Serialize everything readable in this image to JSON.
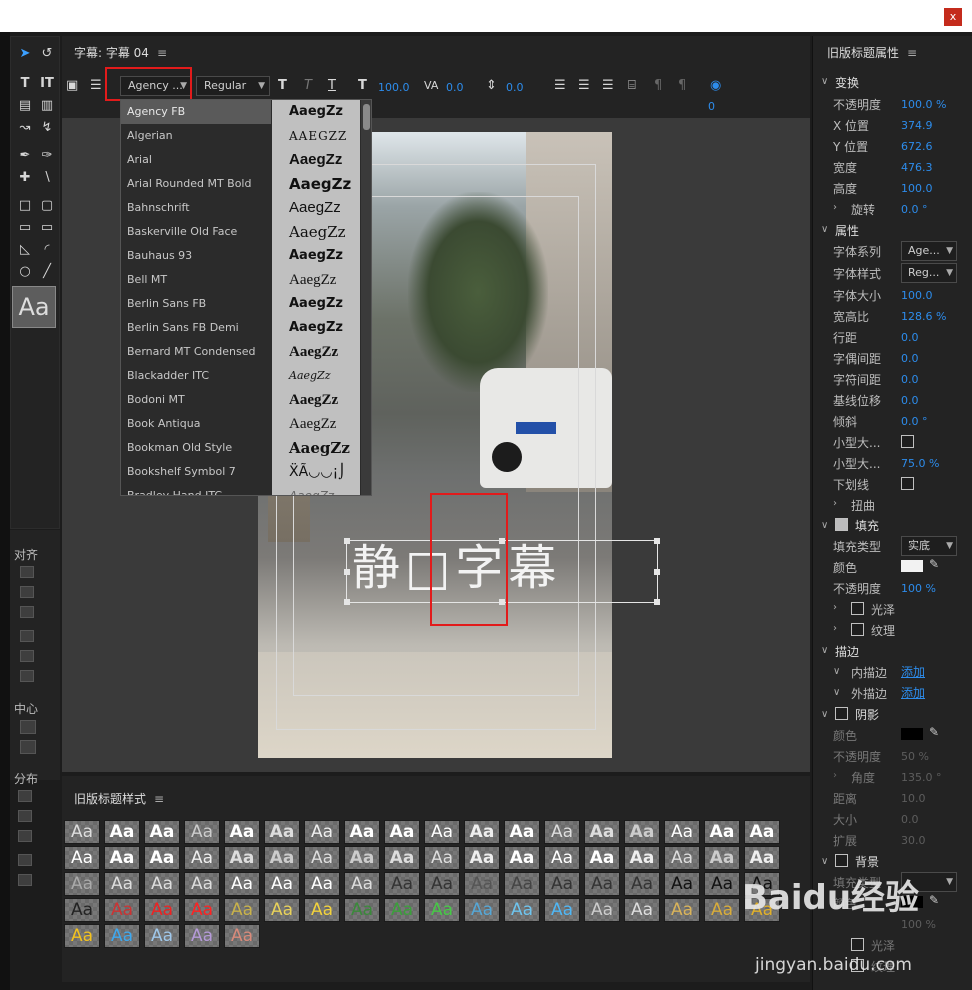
{
  "window": {
    "close_label": "x"
  },
  "title_panel": {
    "title": "字幕: 字幕 04",
    "menu": "≡"
  },
  "toolbar": {
    "font_family": "Agency ...",
    "font_style": "Regular",
    "bold": "T",
    "italic": "T",
    "underline": "T",
    "font_size": "100.0",
    "kerning": "0.0",
    "baseline": "0.0",
    "tab_value": "0"
  },
  "font_list": {
    "items": [
      {
        "name": "Agency FB",
        "preview": "AaegZz"
      },
      {
        "name": "Algerian",
        "preview": "AAEGZZ"
      },
      {
        "name": "Arial",
        "preview": "AaegZz"
      },
      {
        "name": "Arial Rounded MT Bold",
        "preview": "AaegZz"
      },
      {
        "name": "Bahnschrift",
        "preview": "AaegZz"
      },
      {
        "name": "Baskerville Old Face",
        "preview": "AaegZz"
      },
      {
        "name": "Bauhaus 93",
        "preview": "AaegZz"
      },
      {
        "name": "Bell MT",
        "preview": "AaegZz"
      },
      {
        "name": "Berlin Sans FB",
        "preview": "AaegZz"
      },
      {
        "name": "Berlin Sans FB Demi",
        "preview": "AaegZz"
      },
      {
        "name": "Bernard MT Condensed",
        "preview": "AaegZz"
      },
      {
        "name": "Blackadder ITC",
        "preview": "AaegZz"
      },
      {
        "name": "Bodoni MT",
        "preview": "AaegZz"
      },
      {
        "name": "Book Antiqua",
        "preview": "AaegZz"
      },
      {
        "name": "Bookman Old Style",
        "preview": "AaegZz"
      },
      {
        "name": "Bookshelf Symbol 7",
        "preview": "ẌÃ◡◡¡⌡"
      },
      {
        "name": "Bradley Hand ITC",
        "preview": "AaegZz"
      }
    ]
  },
  "canvas": {
    "text": "静□字幕"
  },
  "left_panel": {
    "align": "对齐",
    "center": "中心",
    "distribute": "分布"
  },
  "styles_panel": {
    "title": "旧版标题样式",
    "menu": "≡",
    "swatch_label": "Aa"
  },
  "props": {
    "title": "旧版标题属性",
    "menu": "≡",
    "transform": "变换",
    "opacity_label": "不透明度",
    "opacity": "100.0 %",
    "x_label": "X 位置",
    "x": "374.9",
    "y_label": "Y 位置",
    "y": "672.6",
    "width_label": "宽度",
    "width": "476.3",
    "height_label": "高度",
    "height": "100.0",
    "rotation_label": "旋转",
    "rotation": "0.0 °",
    "attributes": "属性",
    "font_family_label": "字体系列",
    "font_family": "Age...",
    "font_style_label": "字体样式",
    "font_style": "Reg...",
    "font_size_label": "字体大小",
    "font_size": "100.0",
    "aspect_label": "宽高比",
    "aspect": "128.6 %",
    "leading_label": "行距",
    "leading": "0.0",
    "kerning_label": "字偶间距",
    "kerning": "0.0",
    "tracking_label": "字符间距",
    "tracking": "0.0",
    "baseline_label": "基线位移",
    "baseline": "0.0",
    "slant_label": "倾斜",
    "slant": "0.0 °",
    "smallcaps_label": "小型大...",
    "smallcaps_size_label": "小型大...",
    "smallcaps_size": "75.0 %",
    "underline_label": "下划线",
    "distort": "扭曲",
    "fill": "填充",
    "fill_type_label": "填充类型",
    "fill_type": "实底",
    "color_label": "颜色",
    "fill_opacity_label": "不透明度",
    "fill_opacity": "100 %",
    "sheen": "光泽",
    "texture": "纹理",
    "stroke": "描边",
    "inner_stroke": "内描边",
    "outer_stroke": "外描边",
    "add": "添加",
    "shadow": "阴影",
    "shadow_color_label": "颜色",
    "shadow_opacity_label": "不透明度",
    "shadow_opacity": "50 %",
    "angle_label": "角度",
    "angle": "135.0 °",
    "distance_label": "距离",
    "distance": "10.0",
    "size_label": "大小",
    "size": "0.0",
    "spread_label": "扩展",
    "spread": "30.0",
    "background": "背景",
    "bg_fill_type_label": "填充类型",
    "bg_color_label": "颜色",
    "bg_opacity": "100 %",
    "bg_sheen": "光泽",
    "bg_texture": "纹理"
  },
  "watermark": {
    "text": "Baidu经验",
    "sub": "jingyan.baidu.com"
  },
  "colors": {
    "accent": "#2d8ceb",
    "highlight_box": "#e21b1b",
    "panel": "#232323",
    "fill_color": "#f2f2f2",
    "shadow_color": "#000000"
  }
}
